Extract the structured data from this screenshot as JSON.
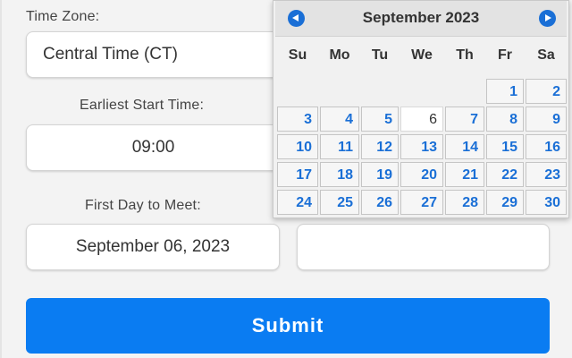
{
  "form": {
    "time_zone_label": "Time Zone:",
    "time_zone_value": "Central Time (CT)",
    "earliest_start_label": "Earliest Start Time:",
    "earliest_start_value": "09:00",
    "first_day_label": "First Day to Meet:",
    "first_day_value": "September 06, 2023",
    "second_date_value": "",
    "submit_label": "Submit"
  },
  "datepicker": {
    "title": "September 2023",
    "prev_icon": "chevron-left-circle-icon",
    "next_icon": "chevron-right-circle-icon",
    "weekdays": [
      "Su",
      "Mo",
      "Tu",
      "We",
      "Th",
      "Fr",
      "Sa"
    ],
    "leading_blank_days": 5,
    "days": [
      "1",
      "2",
      "3",
      "4",
      "5",
      "6",
      "7",
      "8",
      "9",
      "10",
      "11",
      "12",
      "13",
      "14",
      "15",
      "16",
      "17",
      "18",
      "19",
      "20",
      "21",
      "22",
      "23",
      "24",
      "25",
      "26",
      "27",
      "28",
      "29",
      "30"
    ],
    "highlighted_day": "6"
  },
  "colors": {
    "accent": "#0a7cf2",
    "day_link": "#1a6fd6",
    "page_background": "#f3f3f3"
  }
}
